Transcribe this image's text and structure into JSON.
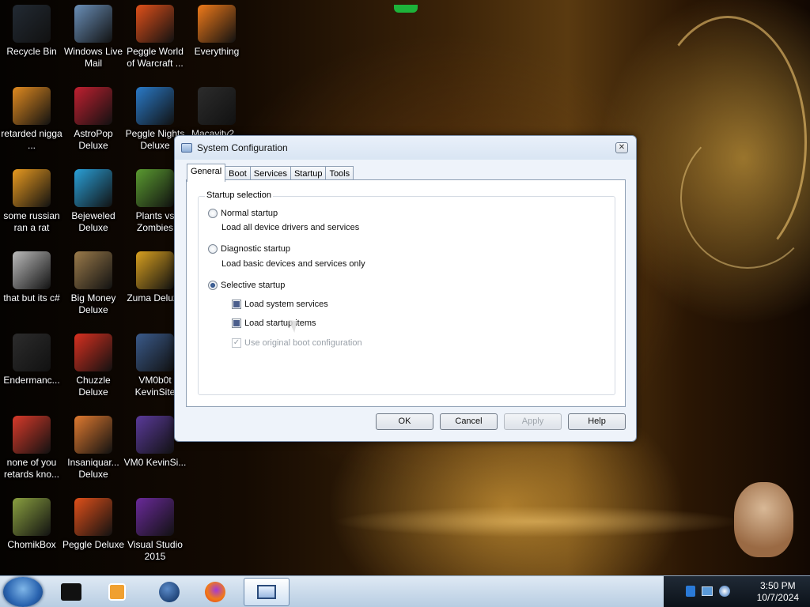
{
  "desktop_icons": [
    {
      "label": "Recycle Bin",
      "icon": "recycle-bin-icon",
      "color": "#222a33"
    },
    {
      "label": "Windows Live Mail",
      "icon": "mail-icon",
      "color": "#6a8fb8"
    },
    {
      "label": "Peggle World of Warcraft ...",
      "icon": "peggle-icon",
      "color": "#e0501a"
    },
    {
      "label": "Everything",
      "icon": "everything-icon",
      "color": "#f07a1a"
    },
    {
      "label": "retarded nigga ...",
      "icon": "folder-icon",
      "color": "#e08a20"
    },
    {
      "label": "AstroPop Deluxe",
      "icon": "astropop-icon",
      "color": "#c02030"
    },
    {
      "label": "Peggle Nights Deluxe",
      "icon": "peggle-icon",
      "color": "#2a7ac8"
    },
    {
      "label": "Macavity2...",
      "icon": "text-file-icon",
      "color": "#2c2c2c"
    },
    {
      "label": "some russian ran a rat",
      "icon": "archive-icon",
      "color": "#e89a20"
    },
    {
      "label": "Bejeweled Deluxe",
      "icon": "bejeweled-icon",
      "color": "#2aa0d8"
    },
    {
      "label": "Plants vs Zombies",
      "icon": "plants-icon",
      "color": "#5a9a30"
    },
    {
      "label": "that but its c#",
      "icon": "shortcut-icon",
      "color": "#bbbbbb"
    },
    {
      "label": "Big Money Deluxe",
      "icon": "bigmoney-icon",
      "color": "#9a7a4a"
    },
    {
      "label": "Zuma Deluxe",
      "icon": "zuma-icon",
      "color": "#d8a020"
    },
    {
      "label": "Endermanc...",
      "icon": "text-file-icon",
      "color": "#2c2c2c"
    },
    {
      "label": "Chuzzle Deluxe",
      "icon": "chuzzle-icon",
      "color": "#d83020"
    },
    {
      "label": "VM0b0t KevinSite",
      "icon": "vm-icon",
      "color": "#3a5a8a"
    },
    {
      "label": "none of you retards kno...",
      "icon": "chrome-icon",
      "color": "#d83a2a"
    },
    {
      "label": "Insaniquar... Deluxe",
      "icon": "insaniquarium-icon",
      "color": "#e07a30"
    },
    {
      "label": "VM0 KevinSi...",
      "icon": "vm-icon",
      "color": "#5a3a9a"
    },
    {
      "label": "ChomikBox",
      "icon": "chomikbox-icon",
      "color": "#8aa040"
    },
    {
      "label": "Peggle Deluxe",
      "icon": "peggle-icon",
      "color": "#e0501a"
    },
    {
      "label": "Visual Studio 2015",
      "icon": "visual-studio-icon",
      "color": "#6a2a9a"
    }
  ],
  "dialog": {
    "title": "System Configuration",
    "tabs": [
      "General",
      "Boot",
      "Services",
      "Startup",
      "Tools"
    ],
    "active_tab": "General",
    "group_label": "Startup selection",
    "options": {
      "normal": {
        "label": "Normal startup",
        "description": "Load all device drivers and services",
        "selected": false
      },
      "diagnostic": {
        "label": "Diagnostic startup",
        "description": "Load basic devices and services only",
        "selected": false
      },
      "selective": {
        "label": "Selective startup",
        "selected": true
      }
    },
    "checks": {
      "load_services": {
        "label": "Load system services",
        "state": "indeterminate"
      },
      "load_startup": {
        "label": "Load startup items",
        "state": "indeterminate"
      },
      "original_boot": {
        "label": "Use original boot configuration",
        "state": "checked-disabled"
      }
    },
    "buttons": {
      "ok": "OK",
      "cancel": "Cancel",
      "apply": "Apply",
      "help": "Help"
    }
  },
  "taskbar": {
    "clock_time": "3:50 PM",
    "clock_date": "10/7/2024"
  }
}
